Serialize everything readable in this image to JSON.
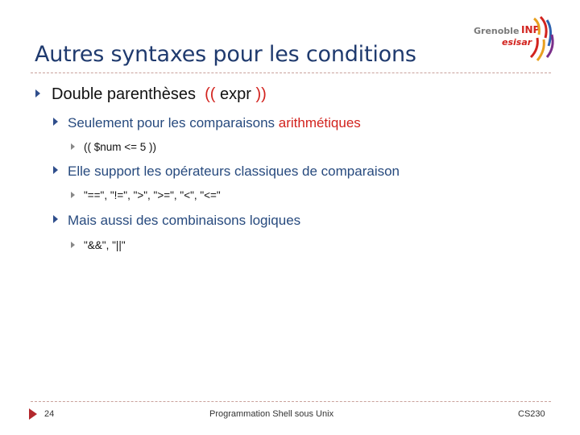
{
  "slide": {
    "title": "Autres syntaxes pour les conditions",
    "logo": {
      "line1": "Grenoble",
      "inp": "INP",
      "line2": "esisar"
    },
    "bullets": {
      "b1": {
        "text_before": "Double parenthèses  ",
        "open": "((",
        "middle": " expr ",
        "close": "))"
      },
      "b1_1": {
        "text": "Seulement pour les comparaisons ",
        "highlight": "arithmétiques"
      },
      "b1_1_1": {
        "text": "(( $num <= 5 ))"
      },
      "b1_2": {
        "text": "Elle support les opérateurs classiques de comparaison"
      },
      "b1_2_1": {
        "text": "\"==\", \"!=\", \">\", \">=\", \"<\", \"<=\""
      },
      "b1_3": {
        "text": "Mais aussi des combinaisons logiques"
      },
      "b1_3_1": {
        "text": "\"&&\", \"||\""
      }
    },
    "footer": {
      "page": "24",
      "center": "Programmation Shell sous Unix",
      "right": "CS230"
    },
    "colors": {
      "title": "#1f3a6e",
      "accent_red": "#d2231e",
      "level2_text": "#274a7e",
      "rule": "#c9a19b"
    }
  }
}
